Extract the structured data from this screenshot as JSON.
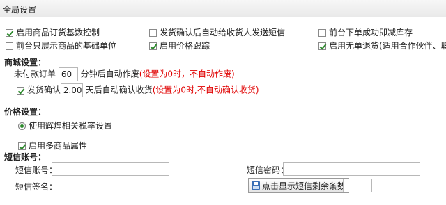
{
  "header": {
    "title": "全局设置"
  },
  "global_checks": [
    {
      "label": "启用商品订货基数控制",
      "checked": true
    },
    {
      "label": "发货确认后自动给收货人发送短信",
      "checked": false
    },
    {
      "label": "前台下单成功即减库存",
      "checked": false
    },
    {
      "label": "前台只展示商品的基础单位",
      "checked": false
    },
    {
      "label": "启用价格跟踪",
      "checked": true
    },
    {
      "label": "启用无单退货(适用合作伙伴、职员)",
      "checked": true
    }
  ],
  "mall": {
    "title": "商城设置：",
    "unpaid_prefix": "未付款订单",
    "unpaid_value": "60",
    "unpaid_suffix": "分钟后自动作废",
    "unpaid_hint": "(设置为0时，不自动作废)",
    "confirm_label": "发货确认",
    "confirm_checked": true,
    "confirm_value": "2.00",
    "confirm_suffix": "天后自动确认收货",
    "confirm_hint": "(设置为0时,不自动确认收货)"
  },
  "price": {
    "title": "价格设置：",
    "radio_label": "使用辉煌相关税率设置",
    "radio_selected": true,
    "multi_label": "启用多商品属性",
    "multi_checked": true
  },
  "sms": {
    "title": "短信账号：",
    "account_label": "短信账号：",
    "account_value": "",
    "password_label": "短信密码：",
    "password_value": "",
    "signature_label": "短信签名：",
    "signature_value": "",
    "remaining_button": "点击显示短信剩余条数",
    "remaining_value": ""
  }
}
